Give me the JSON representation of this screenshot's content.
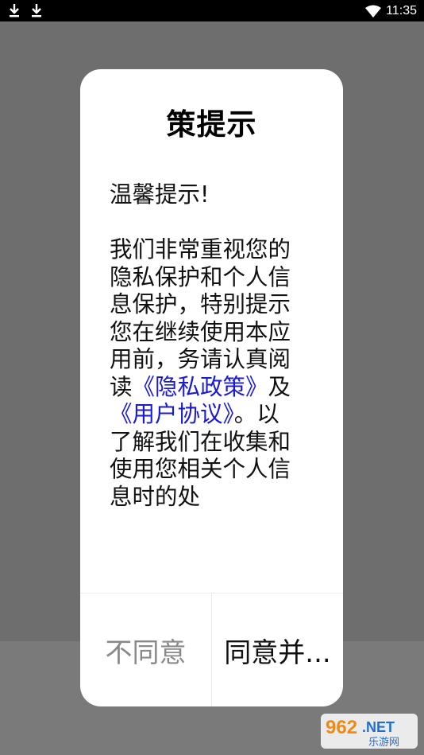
{
  "status_bar": {
    "time": "11:35",
    "left_icons": [
      "download-icon",
      "download-icon"
    ],
    "right_icons": [
      "wifi-icon"
    ]
  },
  "dialog": {
    "title": "策提示",
    "greeting": "温馨提示!",
    "paragraph_before_links": "我们非常重视您的隐私保护和个人信息保护，特别提示您在继续使用本应用前，务请认真阅读",
    "privacy_link": "《隐私政策》",
    "and_text": "及",
    "terms_link": "《用户协议》",
    "after_terms": "。",
    "paragraph_after_links": "以了解我们在收集和使用您相关个人信息时的处",
    "disagree_label": "不同意",
    "agree_label": "同意并..."
  },
  "watermark": {
    "brand": "962",
    "suffix": ".NET",
    "subtitle": "乐游网"
  },
  "colors": {
    "link": "#1a1ad6",
    "overlay": "#6e6e6e",
    "status_bar": "#000000"
  }
}
